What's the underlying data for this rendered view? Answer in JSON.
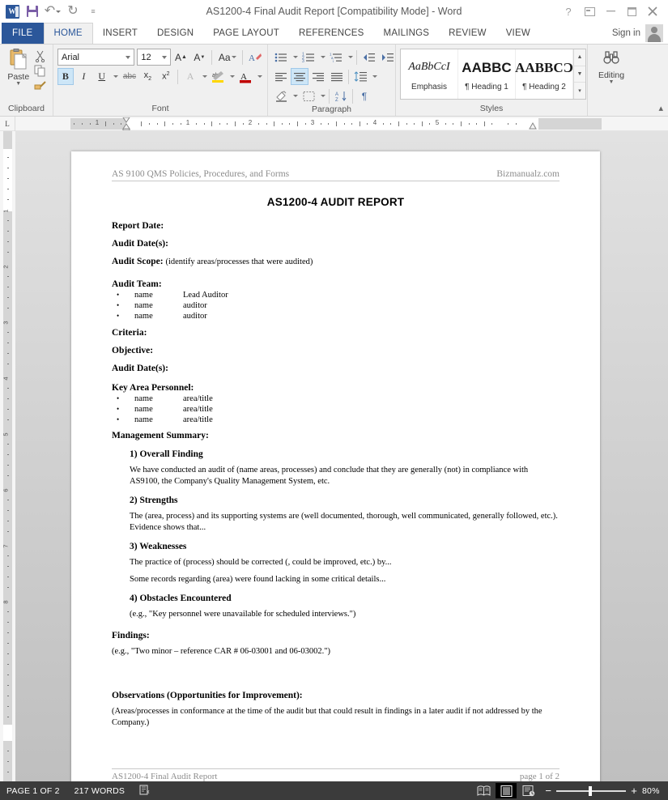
{
  "window": {
    "title": "AS1200-4  Final Audit Report [Compatibility Mode] - Word",
    "quick_access": [
      {
        "name": "word-logo-icon",
        "label": "W"
      },
      {
        "name": "save-icon",
        "label": "Save"
      },
      {
        "name": "undo-icon",
        "label": "Undo"
      },
      {
        "name": "redo-icon",
        "label": "Redo"
      },
      {
        "name": "customize-qat-icon",
        "label": "Customize Quick Access Toolbar"
      }
    ],
    "controls": [
      {
        "name": "help-button",
        "glyph": "?"
      },
      {
        "name": "ribbon-display-options-button",
        "glyph": "▭"
      },
      {
        "name": "minimize-button",
        "glyph": "—"
      },
      {
        "name": "restore-button",
        "glyph": "❐"
      },
      {
        "name": "close-button",
        "glyph": "✕"
      }
    ]
  },
  "tabs": {
    "file": "FILE",
    "items": [
      {
        "label": "HOME",
        "active": true
      },
      {
        "label": "INSERT",
        "active": false
      },
      {
        "label": "DESIGN",
        "active": false
      },
      {
        "label": "PAGE LAYOUT",
        "active": false
      },
      {
        "label": "REFERENCES",
        "active": false
      },
      {
        "label": "MAILINGS",
        "active": false
      },
      {
        "label": "REVIEW",
        "active": false
      },
      {
        "label": "VIEW",
        "active": false
      }
    ],
    "sign_in": "Sign in"
  },
  "ribbon": {
    "clipboard": {
      "label": "Clipboard",
      "paste_label": "Paste",
      "buttons": [
        "cut-icon",
        "copy-icon",
        "format-painter-icon"
      ]
    },
    "font": {
      "label": "Font",
      "font_name": "Arial",
      "font_size": "12",
      "buttons": [
        "grow-font-icon",
        "shrink-font-icon",
        "change-case-icon",
        "clear-formatting-icon",
        "bold-icon",
        "italic-icon",
        "underline-icon",
        "strikethrough-icon",
        "subscript-icon",
        "superscript-icon",
        "text-effects-icon",
        "text-highlight-color-icon",
        "font-color-icon"
      ],
      "bold_active": true
    },
    "paragraph": {
      "label": "Paragraph",
      "buttons": [
        "bullets-icon",
        "numbering-icon",
        "multilevel-list-icon",
        "decrease-indent-icon",
        "increase-indent-icon",
        "align-left-icon",
        "center-icon",
        "align-right-icon",
        "justify-icon",
        "line-spacing-icon",
        "shading-icon",
        "borders-icon",
        "sort-icon",
        "show-formatting-marks-icon"
      ],
      "center_active": true
    },
    "styles": {
      "label": "Styles",
      "items": [
        {
          "preview": "AaBbCcI",
          "name": "Emphasis"
        },
        {
          "preview": "AABBC",
          "name": "¶ Heading 1"
        },
        {
          "preview": "AABBCƆ",
          "name": "¶ Heading 2"
        }
      ]
    },
    "editing": {
      "label": "Editing",
      "button_label": "Editing"
    }
  },
  "ruler": {
    "tab_stop_marker": "L",
    "horizontal_labels": [
      "1",
      "1",
      "2",
      "3",
      "4",
      "5"
    ],
    "vertical_labels": [
      "1",
      "2",
      "3",
      "4",
      "5",
      "6",
      "7",
      "8"
    ]
  },
  "document": {
    "header_left": "AS 9100 QMS Policies, Procedures, and Forms",
    "header_right": "Bizmanualz.com",
    "title": "AS1200-4 AUDIT REPORT",
    "fields": [
      {
        "label": "Report Date:",
        "value": ""
      },
      {
        "label": "Audit Date(s):",
        "value": ""
      },
      {
        "label": "Audit Scope:",
        "value": "(identify areas/processes that were audited)"
      }
    ],
    "audit_team": {
      "label": "Audit Team:",
      "rows": [
        {
          "name": "name",
          "role": "Lead Auditor"
        },
        {
          "name": "name",
          "role": "auditor"
        },
        {
          "name": "name",
          "role": "auditor"
        }
      ]
    },
    "fields2": [
      {
        "label": "Criteria:",
        "value": ""
      },
      {
        "label": "Objective:",
        "value": ""
      },
      {
        "label": "Audit Date(s):",
        "value": ""
      }
    ],
    "key_area_personnel": {
      "label": "Key Area Personnel:",
      "rows": [
        {
          "name": "name",
          "role": "area/title"
        },
        {
          "name": "name",
          "role": "area/title"
        },
        {
          "name": "name",
          "role": "area/title"
        }
      ]
    },
    "management_summary": {
      "label": "Management Summary:",
      "sections": [
        {
          "heading": "1) Overall Finding",
          "paragraphs": [
            "We have conducted an audit of (name areas, processes) and conclude that they are generally (not) in compliance with AS9100, the Company's Quality Management System, etc."
          ]
        },
        {
          "heading": "2) Strengths",
          "paragraphs": [
            "The (area, process) and its supporting systems are (well documented, thorough, well communicated, generally followed, etc.).  Evidence shows that..."
          ]
        },
        {
          "heading": "3) Weaknesses",
          "paragraphs": [
            "The practice of (process) should be corrected (, could be improved, etc.) by...",
            "Some records regarding (area) were found lacking in some critical details..."
          ]
        },
        {
          "heading": "4) Obstacles Encountered",
          "paragraphs": [
            "(e.g., \"Key personnel were unavailable for scheduled interviews.\")"
          ]
        }
      ]
    },
    "findings": {
      "label": "Findings:",
      "text": "(e.g., \"Two minor – reference CAR # 06-03001 and 06-03002.\")"
    },
    "observations": {
      "label": "Observations (Opportunities for Improvement):",
      "text": "(Areas/processes in conformance at the time of the audit but that could result in findings in a later audit if not addressed by the Company.)"
    },
    "footer_left": "AS1200-4  Final Audit Report",
    "footer_right": "page 1 of 2"
  },
  "status_bar": {
    "page_indicator": "PAGE 1 OF 2",
    "word_count": "217 WORDS",
    "proofing_icon": "proofing-errors-icon",
    "view_buttons": [
      {
        "name": "read-mode-icon",
        "selected": false
      },
      {
        "name": "print-layout-icon",
        "selected": true
      },
      {
        "name": "web-layout-icon",
        "selected": false
      }
    ],
    "zoom_out": "−",
    "zoom_in": "+",
    "zoom_level": "80%"
  },
  "colors": {
    "accent": "#2b579a",
    "ribbon_bg": "#f0f0f0",
    "status_bg": "#3b3b3b",
    "workspace_bg": "#cfcfcf"
  }
}
